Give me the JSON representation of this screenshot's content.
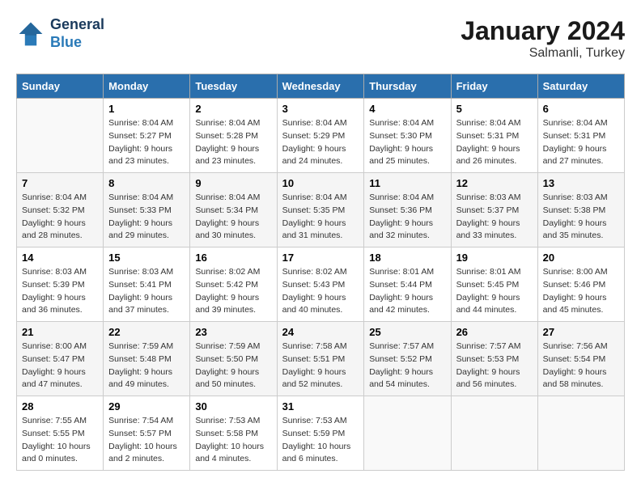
{
  "header": {
    "logo_line1": "General",
    "logo_line2": "Blue",
    "month": "January 2024",
    "location": "Salmanli, Turkey"
  },
  "weekdays": [
    "Sunday",
    "Monday",
    "Tuesday",
    "Wednesday",
    "Thursday",
    "Friday",
    "Saturday"
  ],
  "weeks": [
    [
      {
        "day": "",
        "sunrise": "",
        "sunset": "",
        "daylight": ""
      },
      {
        "day": "1",
        "sunrise": "Sunrise: 8:04 AM",
        "sunset": "Sunset: 5:27 PM",
        "daylight": "Daylight: 9 hours and 23 minutes."
      },
      {
        "day": "2",
        "sunrise": "Sunrise: 8:04 AM",
        "sunset": "Sunset: 5:28 PM",
        "daylight": "Daylight: 9 hours and 23 minutes."
      },
      {
        "day": "3",
        "sunrise": "Sunrise: 8:04 AM",
        "sunset": "Sunset: 5:29 PM",
        "daylight": "Daylight: 9 hours and 24 minutes."
      },
      {
        "day": "4",
        "sunrise": "Sunrise: 8:04 AM",
        "sunset": "Sunset: 5:30 PM",
        "daylight": "Daylight: 9 hours and 25 minutes."
      },
      {
        "day": "5",
        "sunrise": "Sunrise: 8:04 AM",
        "sunset": "Sunset: 5:31 PM",
        "daylight": "Daylight: 9 hours and 26 minutes."
      },
      {
        "day": "6",
        "sunrise": "Sunrise: 8:04 AM",
        "sunset": "Sunset: 5:31 PM",
        "daylight": "Daylight: 9 hours and 27 minutes."
      }
    ],
    [
      {
        "day": "7",
        "sunrise": "Sunrise: 8:04 AM",
        "sunset": "Sunset: 5:32 PM",
        "daylight": "Daylight: 9 hours and 28 minutes."
      },
      {
        "day": "8",
        "sunrise": "Sunrise: 8:04 AM",
        "sunset": "Sunset: 5:33 PM",
        "daylight": "Daylight: 9 hours and 29 minutes."
      },
      {
        "day": "9",
        "sunrise": "Sunrise: 8:04 AM",
        "sunset": "Sunset: 5:34 PM",
        "daylight": "Daylight: 9 hours and 30 minutes."
      },
      {
        "day": "10",
        "sunrise": "Sunrise: 8:04 AM",
        "sunset": "Sunset: 5:35 PM",
        "daylight": "Daylight: 9 hours and 31 minutes."
      },
      {
        "day": "11",
        "sunrise": "Sunrise: 8:04 AM",
        "sunset": "Sunset: 5:36 PM",
        "daylight": "Daylight: 9 hours and 32 minutes."
      },
      {
        "day": "12",
        "sunrise": "Sunrise: 8:03 AM",
        "sunset": "Sunset: 5:37 PM",
        "daylight": "Daylight: 9 hours and 33 minutes."
      },
      {
        "day": "13",
        "sunrise": "Sunrise: 8:03 AM",
        "sunset": "Sunset: 5:38 PM",
        "daylight": "Daylight: 9 hours and 35 minutes."
      }
    ],
    [
      {
        "day": "14",
        "sunrise": "Sunrise: 8:03 AM",
        "sunset": "Sunset: 5:39 PM",
        "daylight": "Daylight: 9 hours and 36 minutes."
      },
      {
        "day": "15",
        "sunrise": "Sunrise: 8:03 AM",
        "sunset": "Sunset: 5:41 PM",
        "daylight": "Daylight: 9 hours and 37 minutes."
      },
      {
        "day": "16",
        "sunrise": "Sunrise: 8:02 AM",
        "sunset": "Sunset: 5:42 PM",
        "daylight": "Daylight: 9 hours and 39 minutes."
      },
      {
        "day": "17",
        "sunrise": "Sunrise: 8:02 AM",
        "sunset": "Sunset: 5:43 PM",
        "daylight": "Daylight: 9 hours and 40 minutes."
      },
      {
        "day": "18",
        "sunrise": "Sunrise: 8:01 AM",
        "sunset": "Sunset: 5:44 PM",
        "daylight": "Daylight: 9 hours and 42 minutes."
      },
      {
        "day": "19",
        "sunrise": "Sunrise: 8:01 AM",
        "sunset": "Sunset: 5:45 PM",
        "daylight": "Daylight: 9 hours and 44 minutes."
      },
      {
        "day": "20",
        "sunrise": "Sunrise: 8:00 AM",
        "sunset": "Sunset: 5:46 PM",
        "daylight": "Daylight: 9 hours and 45 minutes."
      }
    ],
    [
      {
        "day": "21",
        "sunrise": "Sunrise: 8:00 AM",
        "sunset": "Sunset: 5:47 PM",
        "daylight": "Daylight: 9 hours and 47 minutes."
      },
      {
        "day": "22",
        "sunrise": "Sunrise: 7:59 AM",
        "sunset": "Sunset: 5:48 PM",
        "daylight": "Daylight: 9 hours and 49 minutes."
      },
      {
        "day": "23",
        "sunrise": "Sunrise: 7:59 AM",
        "sunset": "Sunset: 5:50 PM",
        "daylight": "Daylight: 9 hours and 50 minutes."
      },
      {
        "day": "24",
        "sunrise": "Sunrise: 7:58 AM",
        "sunset": "Sunset: 5:51 PM",
        "daylight": "Daylight: 9 hours and 52 minutes."
      },
      {
        "day": "25",
        "sunrise": "Sunrise: 7:57 AM",
        "sunset": "Sunset: 5:52 PM",
        "daylight": "Daylight: 9 hours and 54 minutes."
      },
      {
        "day": "26",
        "sunrise": "Sunrise: 7:57 AM",
        "sunset": "Sunset: 5:53 PM",
        "daylight": "Daylight: 9 hours and 56 minutes."
      },
      {
        "day": "27",
        "sunrise": "Sunrise: 7:56 AM",
        "sunset": "Sunset: 5:54 PM",
        "daylight": "Daylight: 9 hours and 58 minutes."
      }
    ],
    [
      {
        "day": "28",
        "sunrise": "Sunrise: 7:55 AM",
        "sunset": "Sunset: 5:55 PM",
        "daylight": "Daylight: 10 hours and 0 minutes."
      },
      {
        "day": "29",
        "sunrise": "Sunrise: 7:54 AM",
        "sunset": "Sunset: 5:57 PM",
        "daylight": "Daylight: 10 hours and 2 minutes."
      },
      {
        "day": "30",
        "sunrise": "Sunrise: 7:53 AM",
        "sunset": "Sunset: 5:58 PM",
        "daylight": "Daylight: 10 hours and 4 minutes."
      },
      {
        "day": "31",
        "sunrise": "Sunrise: 7:53 AM",
        "sunset": "Sunset: 5:59 PM",
        "daylight": "Daylight: 10 hours and 6 minutes."
      },
      {
        "day": "",
        "sunrise": "",
        "sunset": "",
        "daylight": ""
      },
      {
        "day": "",
        "sunrise": "",
        "sunset": "",
        "daylight": ""
      },
      {
        "day": "",
        "sunrise": "",
        "sunset": "",
        "daylight": ""
      }
    ]
  ]
}
